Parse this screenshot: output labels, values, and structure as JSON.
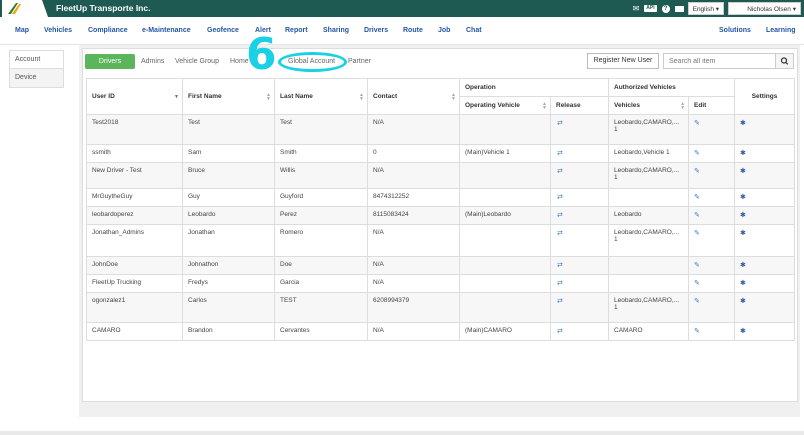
{
  "company": "FleetUp Transporte Inc.",
  "topbar": {
    "api_label": "API",
    "help_label": "?",
    "language": "English ▾",
    "user": "Nicholas Olsen ▾"
  },
  "nav": {
    "items": [
      "Map",
      "Vehicles",
      "Compliance",
      "e-Maintenance",
      "Geofence",
      "Alert",
      "Report",
      "Sharing",
      "Drivers",
      "Route",
      "Job",
      "Chat"
    ],
    "right_items": [
      "Solutions",
      "Learning"
    ]
  },
  "left_menu": [
    "Account",
    "Device"
  ],
  "tabs": {
    "active": "Drivers",
    "items": [
      "Admins",
      "Vehicle Group",
      "Home",
      "Global Account",
      "Partner"
    ]
  },
  "annotation_number": "6",
  "register_button": "Register New User",
  "search_placeholder": "Search all item",
  "table": {
    "headers": {
      "user_id": "User ID",
      "first_name": "First Name",
      "last_name": "Last Name",
      "contact": "Contact",
      "operation": "Operation",
      "operating_vehicle": "Operating Vehicle",
      "release": "Release",
      "authorized_vehicles": "Authorized Vehicles",
      "vehicles": "Vehicles",
      "edit": "Edit",
      "settings": "Settings"
    },
    "rows": [
      {
        "user_id": "Test2018",
        "first": "Test",
        "last": "Test",
        "contact": "N/A",
        "op_vehicle": "",
        "vehicles": "Leobardo,CAMARO,... 1"
      },
      {
        "user_id": "ssmith",
        "first": "Sam",
        "last": "Smith",
        "contact": "0",
        "op_vehicle": "(Main)Vehicle 1",
        "vehicles": "Leobardo,Vehicle 1"
      },
      {
        "user_id": "New Driver - Test",
        "first": "Bruce",
        "last": "Willis",
        "contact": "N/A",
        "op_vehicle": "",
        "vehicles": "Leobardo,CAMARO,... 1"
      },
      {
        "user_id": "MrGuytheGuy",
        "first": "Guy",
        "last": "Guyford",
        "contact": "8474312252",
        "op_vehicle": "",
        "vehicles": ""
      },
      {
        "user_id": "leobardoperez",
        "first": "Leobardo",
        "last": "Perez",
        "contact": "8115083424",
        "op_vehicle": "(Main)Leobardo",
        "vehicles": "Leobardo"
      },
      {
        "user_id": "Jonathan_Admins",
        "first": "Jonathan",
        "last": "Romero",
        "contact": "N/A",
        "op_vehicle": "",
        "vehicles": "Leobardo,CAMARO,... 1"
      },
      {
        "user_id": "JohnDoe",
        "first": "Johnathon",
        "last": "Doe",
        "contact": "N/A",
        "op_vehicle": "",
        "vehicles": ""
      },
      {
        "user_id": "FleetUp Trucking",
        "first": "Fredys",
        "last": "Garcia",
        "contact": "N/A",
        "op_vehicle": "",
        "vehicles": ""
      },
      {
        "user_id": "ogonzalez1",
        "first": "Carlos",
        "last": "TEST",
        "contact": "6208994379",
        "op_vehicle": "",
        "vehicles": "Leobardo,CAMARO,... 1"
      },
      {
        "user_id": "CAMARO",
        "first": "Brandon",
        "last": "Cervantes",
        "contact": "N/A",
        "op_vehicle": "(Main)CAMARO",
        "vehicles": "CAMARO"
      }
    ]
  }
}
